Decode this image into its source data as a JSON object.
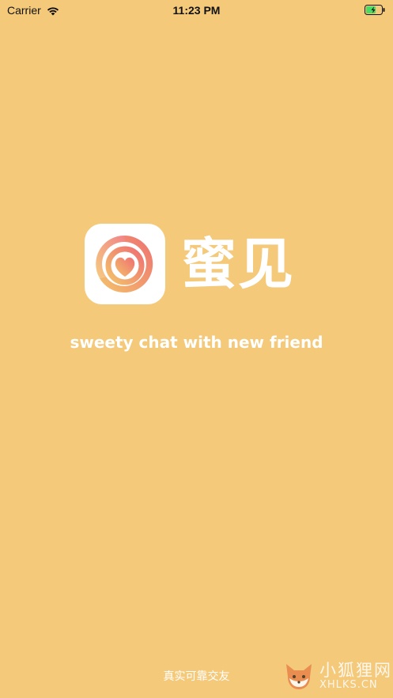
{
  "status_bar": {
    "carrier": "Carrier",
    "time": "11:23 PM",
    "wifi_icon": "wifi-icon",
    "battery_icon": "battery-charging-icon"
  },
  "splash": {
    "app_icon": "heart-swirl-logo-icon",
    "brand_name": "蜜见",
    "tagline": "sweety chat with new friend",
    "bottom_text": "真实可靠交友",
    "background_color": "#F4C97A",
    "accent_gradient": [
      "#F4C26A",
      "#EE6F72"
    ]
  },
  "watermark": {
    "icon": "fox-icon",
    "title": "小狐狸网",
    "subtitle": "XHLKS.CN"
  }
}
